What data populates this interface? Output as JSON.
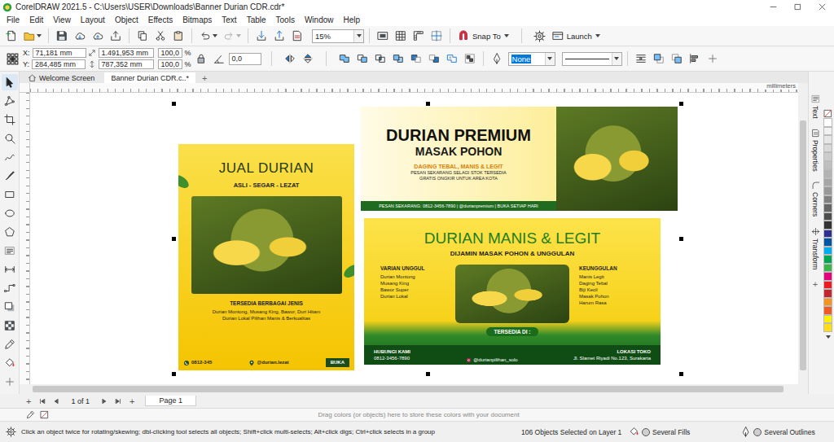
{
  "window": {
    "title": "CorelDRAW 2021.5 - C:\\Users\\USER\\Downloads\\Banner Durian CDR.cdr*"
  },
  "menu": [
    "File",
    "Edit",
    "View",
    "Layout",
    "Object",
    "Effects",
    "Bitmaps",
    "Text",
    "Table",
    "Tools",
    "Window",
    "Help"
  ],
  "toolbar": {
    "zoom": "15%",
    "snap_to": "Snap To",
    "launch": "Launch"
  },
  "property_bar": {
    "x_label": "X:",
    "x": "71,181 mm",
    "y_label": "Y:",
    "y": "284,485 mm",
    "width": "1.491,953 mm",
    "height": "787,352 mm",
    "scale_x": "100,0",
    "scale_y": "100,0",
    "unit": "%",
    "angle": "0,0",
    "fill": "None",
    "fill_highlighted": true
  },
  "tabs": [
    {
      "label": "Welcome Screen",
      "selected": false
    },
    {
      "label": "Banner Durian CDR.c..*",
      "selected": true
    }
  ],
  "new_tab": "+",
  "ruler": {
    "unit": "millimeters"
  },
  "document": {
    "portrait": {
      "title": "JUAL DURIAN",
      "subtitle": "ASLI - SEGAR - LEZAT",
      "heading": "TERSEDIA BERBAGAI JENIS",
      "lines": [
        "Durian Montong, Musang King, Bawor, Duri Hitam",
        "Durian Lokal Pilihan Manis & Berkualitas"
      ],
      "contacts": [
        "0812-345",
        "@durian.lezat",
        "BUKA"
      ]
    },
    "top": {
      "title": "DURIAN PREMIUM",
      "subtitle": "MASAK POHON",
      "tagline": "DAGING TEBAL, MANIS & LEGIT",
      "lines": [
        "PESAN SEKARANG SELAGI STOK TERSEDIA",
        "GRATIS ONGKIR UNTUK AREA KOTA"
      ],
      "contact": "PESAN SEKARANG: 0812-3456-7890 | @durianpremium | BUKA SETIAP HARI"
    },
    "bottom": {
      "title": "DURIAN MANIS & LEGIT",
      "subtitle": "DIJAMIN MASAK POHON & UNGGULAN",
      "left_heading": "VARIAN UNGGUL",
      "left_items": [
        "Durian Montong",
        "Musang King",
        "Bawor Super",
        "Durian Lokal"
      ],
      "right_heading": "KEUNGGULAN",
      "right_items": [
        "Manis Legit",
        "Daging Tebal",
        "Biji Kecil",
        "Masak Pohon",
        "Harum Rasa"
      ],
      "available": "TERSEDIA DI :",
      "contact_heading": "HUBUNGI KAMI",
      "phone": "0812-3456-7890",
      "social": "@durianpilihan_solo",
      "location_heading": "LOKASI TOKO",
      "address": "Jl. Slamet Riyadi No.123, Surakarta"
    }
  },
  "dockers": [
    {
      "label": "Text"
    },
    {
      "label": "Properties"
    },
    {
      "label": "Corners"
    },
    {
      "label": "Transform"
    }
  ],
  "docker_add": "+",
  "palette": [
    {
      "color": "#ffffff"
    },
    {
      "color": "#f2f2f2"
    },
    {
      "color": "#e6e6e6"
    },
    {
      "color": "#d9d9d9"
    },
    {
      "color": "#cccccc"
    },
    {
      "color": "#bfbfbf"
    },
    {
      "color": "#b3b3b3"
    },
    {
      "color": "#a6a6a6"
    },
    {
      "color": "#999999"
    },
    {
      "color": "#808080"
    },
    {
      "color": "#666666"
    },
    {
      "color": "#4d4d4d"
    },
    {
      "color": "#333333"
    },
    {
      "color": "#2e3192"
    },
    {
      "color": "#0054a6"
    },
    {
      "color": "#00aeef"
    },
    {
      "color": "#00a651"
    },
    {
      "color": "#39b54a"
    },
    {
      "color": "#e6007e"
    },
    {
      "color": "#ed1c24"
    },
    {
      "color": "#c1272d"
    },
    {
      "color": "#f7941d"
    },
    {
      "color": "#f15a24"
    },
    {
      "color": "#fff200"
    },
    {
      "color": "#ffde17"
    }
  ],
  "page_nav": {
    "add_before": "+",
    "position": "1 of 1",
    "add_after": "+",
    "page_tab": "Page 1"
  },
  "color_bar": {
    "hint": "Drag colors (or objects) here to store these colors with your document"
  },
  "status_bar": {
    "hint": "Click an object twice for rotating/skewing; dbl-clicking tool selects all objects; Shift+click multi-selects; Alt+click digs; Ctrl+click selects in a group",
    "selection": "106 Objects Selected on Layer 1",
    "fill": "Several Fills",
    "outline": "Several Outlines"
  }
}
